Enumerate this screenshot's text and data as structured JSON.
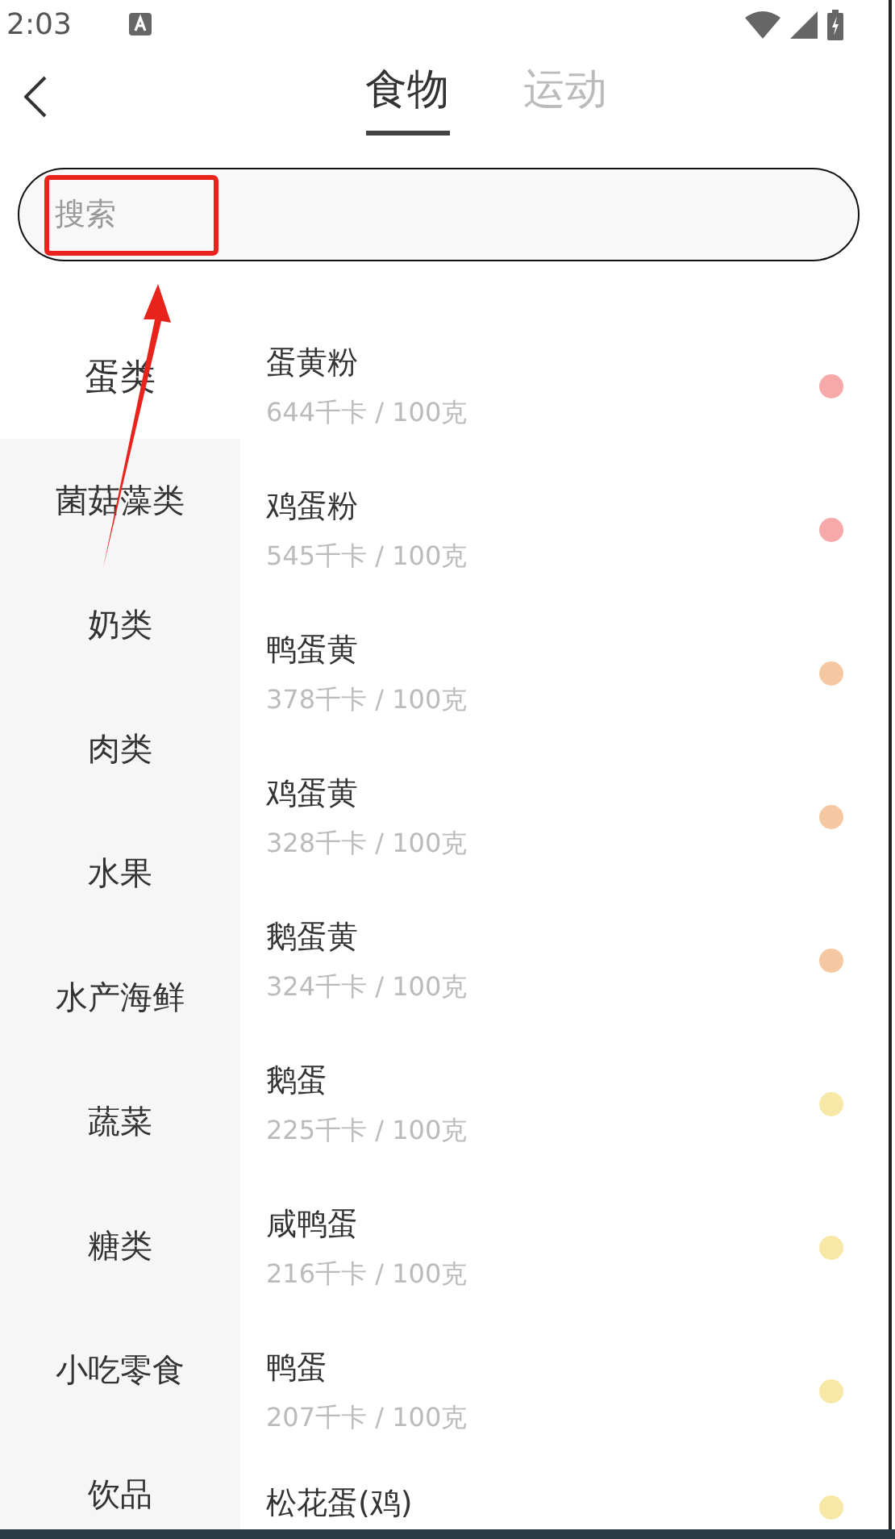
{
  "status_bar": {
    "time": "2:03"
  },
  "tabs": [
    {
      "label": "食物",
      "selected": true
    },
    {
      "label": "运动",
      "selected": false
    }
  ],
  "search": {
    "placeholder": "搜索"
  },
  "categories": [
    {
      "label": "蛋类",
      "selected": true
    },
    {
      "label": "菌菇藻类",
      "selected": false
    },
    {
      "label": "奶类",
      "selected": false
    },
    {
      "label": "肉类",
      "selected": false
    },
    {
      "label": "水果",
      "selected": false
    },
    {
      "label": "水产海鲜",
      "selected": false
    },
    {
      "label": "蔬菜",
      "selected": false
    },
    {
      "label": "糖类",
      "selected": false
    },
    {
      "label": "小吃零食",
      "selected": false
    },
    {
      "label": "饮品",
      "selected": false
    }
  ],
  "foods": [
    {
      "name": "蛋黄粉",
      "calories": "644千卡 / 100克",
      "color": "#f7a8a8"
    },
    {
      "name": "鸡蛋粉",
      "calories": "545千卡 / 100克",
      "color": "#f7a8a8"
    },
    {
      "name": "鸭蛋黄",
      "calories": "378千卡 / 100克",
      "color": "#f5c8a2"
    },
    {
      "name": "鸡蛋黄",
      "calories": "328千卡 / 100克",
      "color": "#f5c8a2"
    },
    {
      "name": "鹅蛋黄",
      "calories": "324千卡 / 100克",
      "color": "#f5c8a2"
    },
    {
      "name": "鹅蛋",
      "calories": "225千卡 / 100克",
      "color": "#f7e8a8"
    },
    {
      "name": "咸鸭蛋",
      "calories": "216千卡 / 100克",
      "color": "#f7e8a8"
    },
    {
      "name": "鸭蛋",
      "calories": "207千卡 / 100克",
      "color": "#f7e8a8"
    },
    {
      "name": "松花蛋(鸡)",
      "color": "#f7e8a8"
    }
  ]
}
